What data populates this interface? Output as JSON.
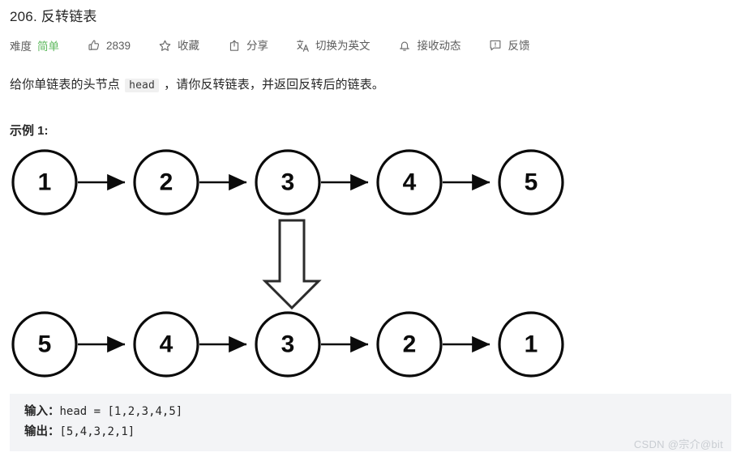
{
  "header": {
    "title": "206. 反转链表"
  },
  "meta": {
    "difficulty_label": "难度",
    "difficulty_value": "简单",
    "difficulty_color": "#5cb85c",
    "actions": [
      {
        "id": "like",
        "icon": "thumbs-up-icon",
        "label": "2839"
      },
      {
        "id": "favorite",
        "icon": "star-icon",
        "label": "收藏"
      },
      {
        "id": "share",
        "icon": "share-icon",
        "label": "分享"
      },
      {
        "id": "translate",
        "icon": "translate-icon",
        "label": "切换为英文"
      },
      {
        "id": "subscribe",
        "icon": "bell-icon",
        "label": "接收动态"
      },
      {
        "id": "feedback",
        "icon": "feedback-icon",
        "label": "反馈"
      }
    ]
  },
  "description": {
    "before_code": "给你单链表的头节点 ",
    "code": "head",
    "after_code": " ，请你反转链表，并返回反转后的链表。"
  },
  "example": {
    "heading": "示例 1:"
  },
  "diagram": {
    "top_row": [
      "1",
      "2",
      "3",
      "4",
      "5"
    ],
    "bottom_row": [
      "5",
      "4",
      "3",
      "2",
      "1"
    ],
    "arrow_direction": "down",
    "node_stroke": "#0b0b0b",
    "node_fill": "#ffffff"
  },
  "code_block": {
    "input_label": "输入：",
    "input_value": "head = [1,2,3,4,5]",
    "output_label": "输出：",
    "output_value": "[5,4,3,2,1]"
  },
  "watermark": {
    "text": "CSDN @宗介@bit"
  }
}
